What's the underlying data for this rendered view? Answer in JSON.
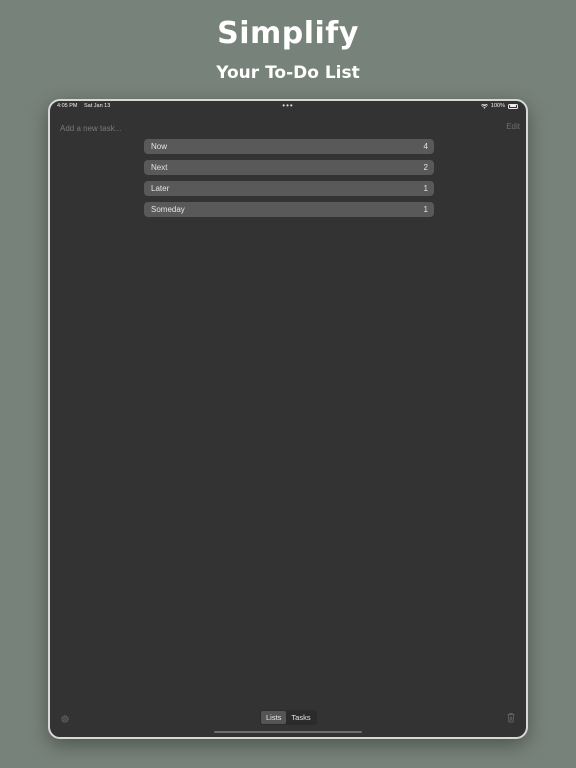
{
  "header": {
    "title": "Simplify",
    "subtitle": "Your To-Do List"
  },
  "status_bar": {
    "time": "4:05 PM",
    "date": "Sat Jan 13",
    "battery": "100%"
  },
  "toolbar": {
    "input_placeholder": "Add a new task...",
    "edit_label": "Edit"
  },
  "lists": [
    {
      "name": "Now",
      "count": "4"
    },
    {
      "name": "Next",
      "count": "2"
    },
    {
      "name": "Later",
      "count": "1"
    },
    {
      "name": "Someday",
      "count": "1"
    }
  ],
  "bottom_bar": {
    "segments": [
      "Lists",
      "Tasks"
    ],
    "selected": "Lists"
  },
  "icons": [
    "gear-icon",
    "trash-icon",
    "wifi-icon",
    "battery-icon"
  ],
  "colors": {
    "background": "#77827a",
    "device_screen": "#333333",
    "row": "#595959"
  }
}
